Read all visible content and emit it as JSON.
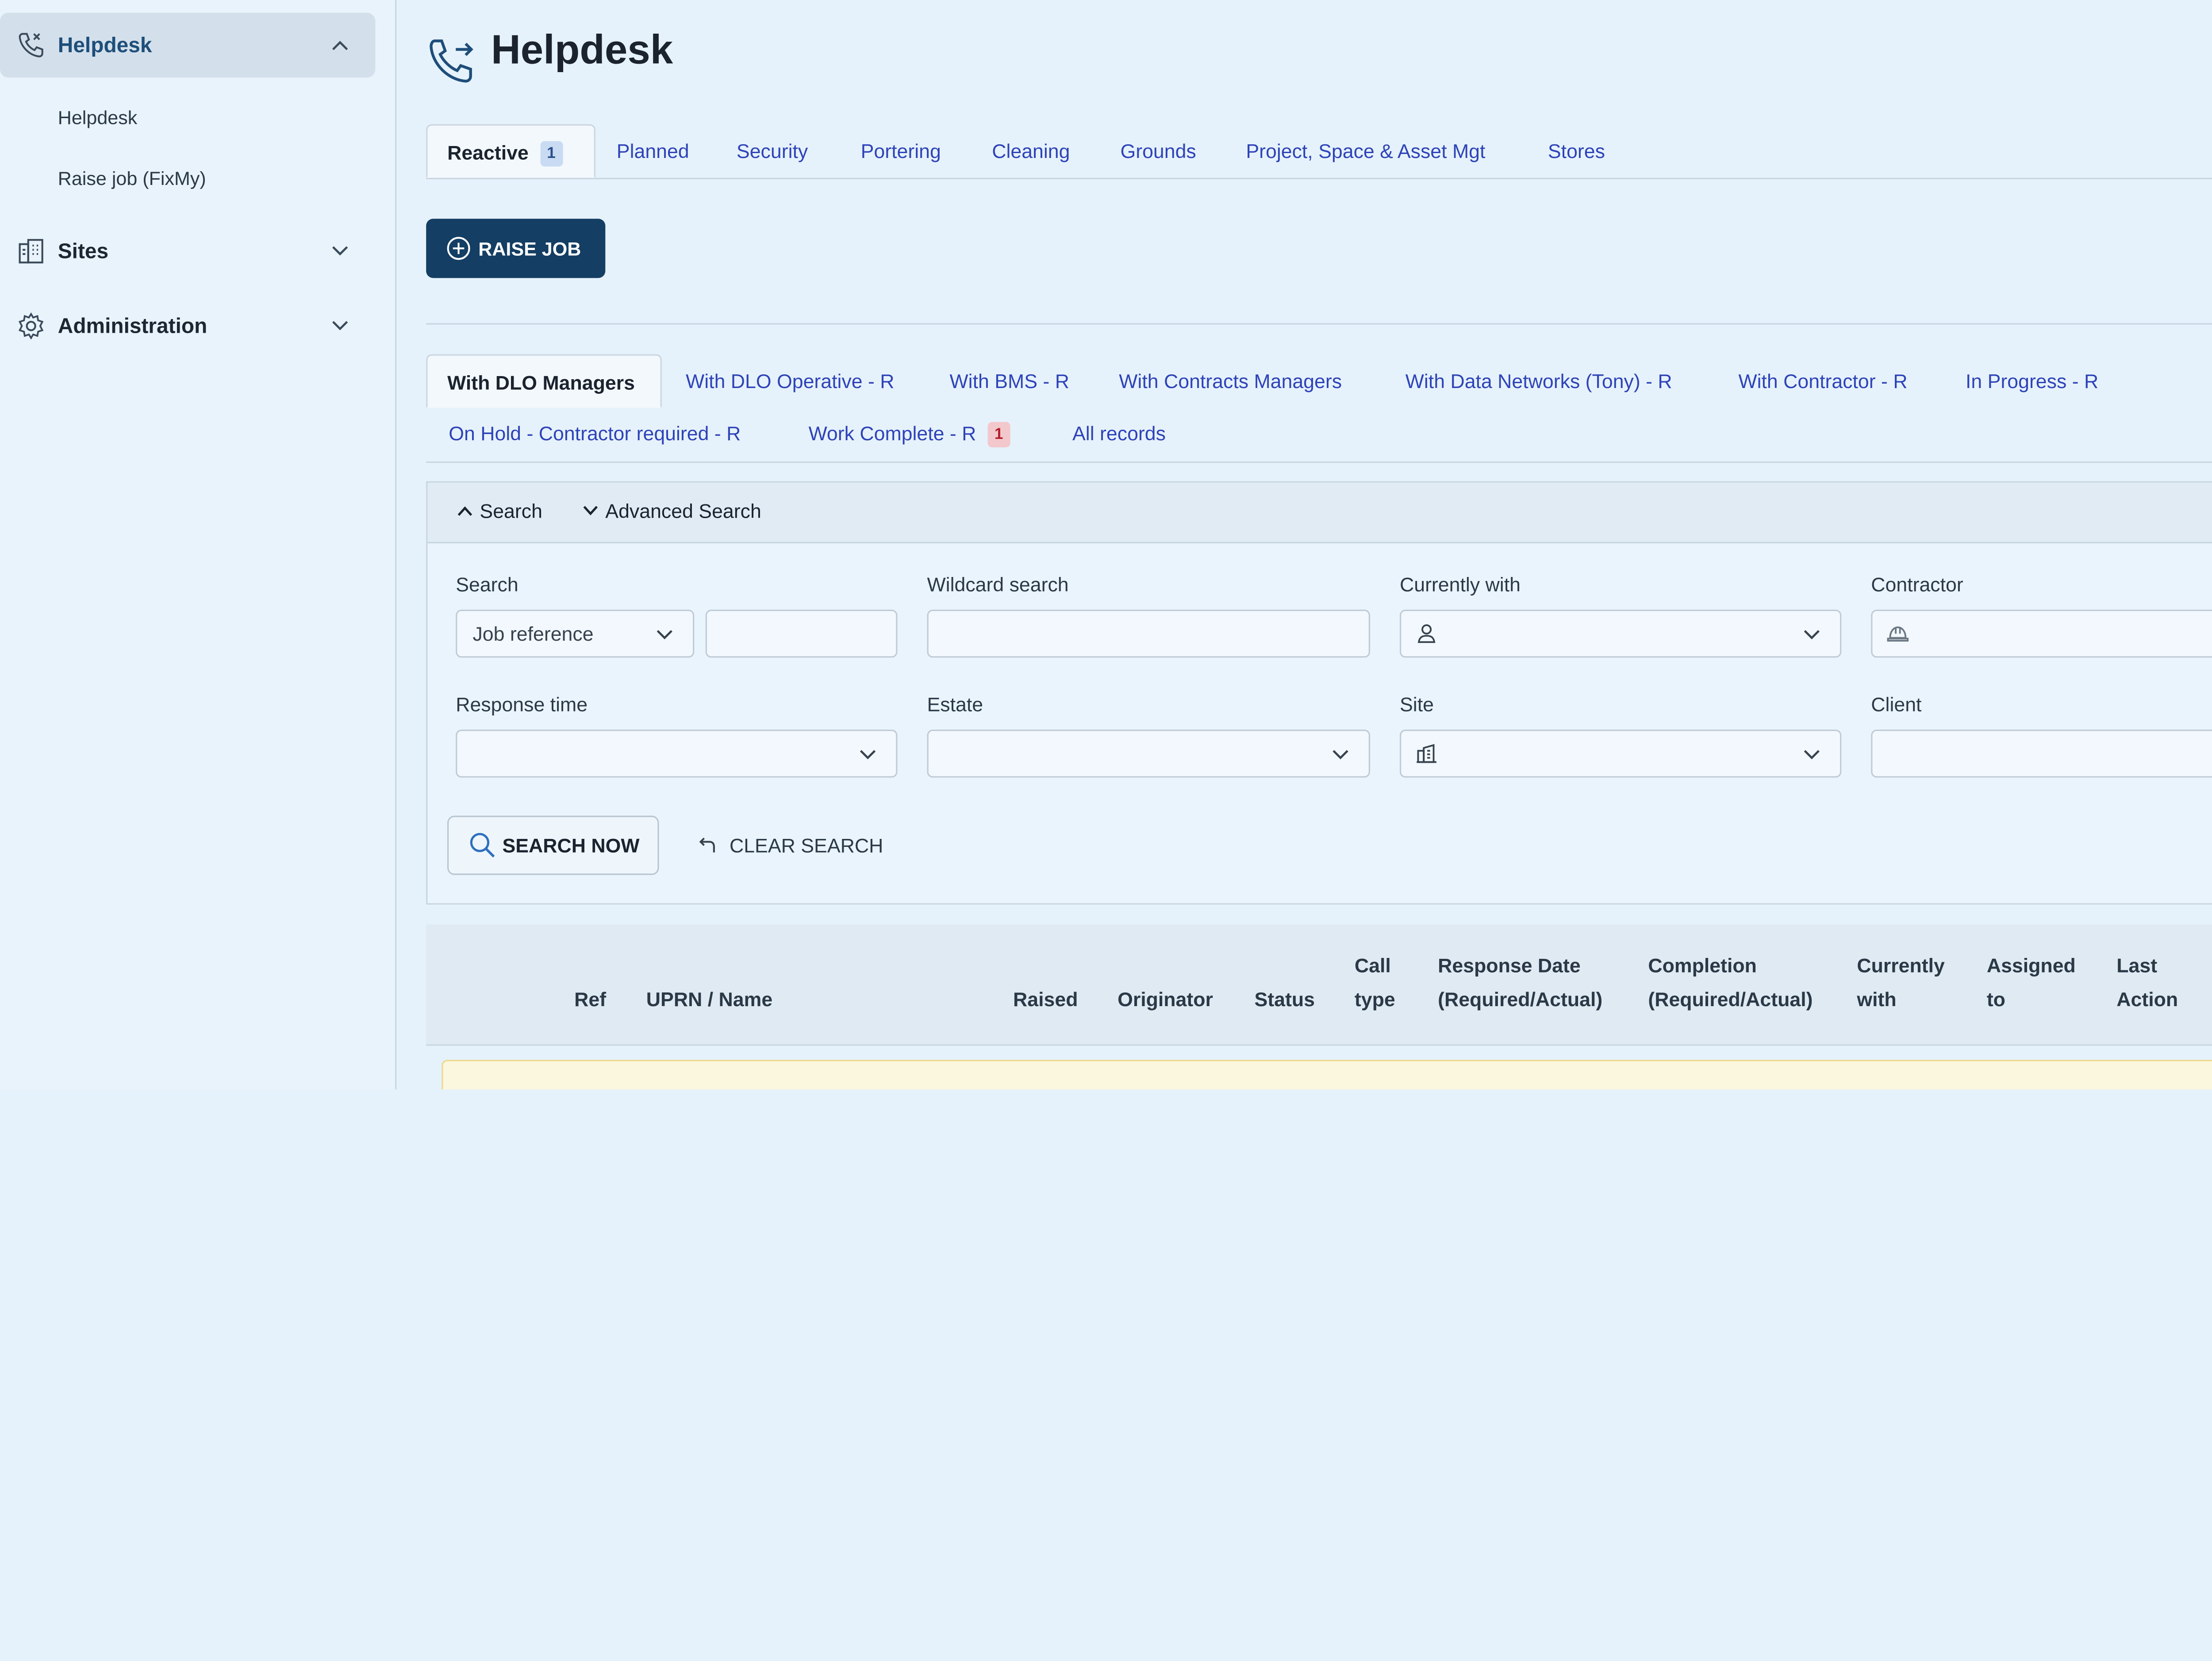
{
  "sidebar": {
    "helpdesk": {
      "label": "Helpdesk",
      "icon": "phone-icon",
      "expanded": true,
      "items": [
        {
          "label": "Helpdesk"
        },
        {
          "label": "Raise job (FixMy)"
        }
      ]
    },
    "sites": {
      "label": "Sites",
      "icon": "building-icon",
      "expanded": false
    },
    "administration": {
      "label": "Administration",
      "icon": "gear-icon",
      "expanded": false
    }
  },
  "page": {
    "title": "Helpdesk",
    "icon": "phone-forward-icon"
  },
  "top_tabs": [
    {
      "label": "Reactive",
      "badge": "1",
      "active": true
    },
    {
      "label": "Planned"
    },
    {
      "label": "Security"
    },
    {
      "label": "Portering"
    },
    {
      "label": "Cleaning"
    },
    {
      "label": "Grounds"
    },
    {
      "label": "Project, Space & Asset Mgt"
    },
    {
      "label": "Stores"
    }
  ],
  "raise_job": {
    "label": "RAISE JOB",
    "icon": "plus-circle-icon"
  },
  "status_tabs": [
    {
      "label": "With DLO Managers",
      "active": true
    },
    {
      "label": "With DLO Operative - R"
    },
    {
      "label": "With BMS - R"
    },
    {
      "label": "With Contracts Managers"
    },
    {
      "label": "With Data Networks (Tony) - R"
    },
    {
      "label": "With Contractor - R"
    },
    {
      "label": "In Progress - R"
    },
    {
      "label": "On Hold - Contractor required - R"
    },
    {
      "label": "Work Complete - R",
      "badge": "1"
    },
    {
      "label": "All records"
    }
  ],
  "search_panel": {
    "toggle_search": "Search",
    "toggle_advanced": "Advanced Search",
    "fields": {
      "search": {
        "label": "Search",
        "selected": "Job reference",
        "value": ""
      },
      "wildcard": {
        "label": "Wildcard search",
        "value": ""
      },
      "currently_with": {
        "label": "Currently with",
        "icon": "user-icon",
        "value": ""
      },
      "contractor": {
        "label": "Contractor",
        "icon": "hard-hat-icon",
        "value": ""
      },
      "response_time": {
        "label": "Response time",
        "value": ""
      },
      "estate": {
        "label": "Estate",
        "value": ""
      },
      "site": {
        "label": "Site",
        "icon": "building-icon",
        "value": ""
      },
      "client": {
        "label": "Client",
        "value": ""
      }
    },
    "search_now": "SEARCH NOW",
    "clear_search": "CLEAR SEARCH"
  },
  "table": {
    "columns": [
      {
        "line1": "",
        "line2": "Ref"
      },
      {
        "line1": "",
        "line2": "UPRN / Name"
      },
      {
        "line1": "",
        "line2": "Raised"
      },
      {
        "line1": "",
        "line2": "Originator"
      },
      {
        "line1": "",
        "line2": "Status"
      },
      {
        "line1": "Call",
        "line2": "type"
      },
      {
        "line1": "Response Date",
        "line2": "(Required/Actual)"
      },
      {
        "line1": "Completion",
        "line2": "(Required/Actual)"
      },
      {
        "line1": "Currently",
        "line2": "with"
      },
      {
        "line1": "Assigned",
        "line2": "to"
      },
      {
        "line1": "Last",
        "line2": "Action"
      }
    ]
  },
  "colors": {
    "accent": "#143e63",
    "link": "#2e43b8",
    "background": "#e6f2fb",
    "badge_red": "#b21e2c"
  }
}
